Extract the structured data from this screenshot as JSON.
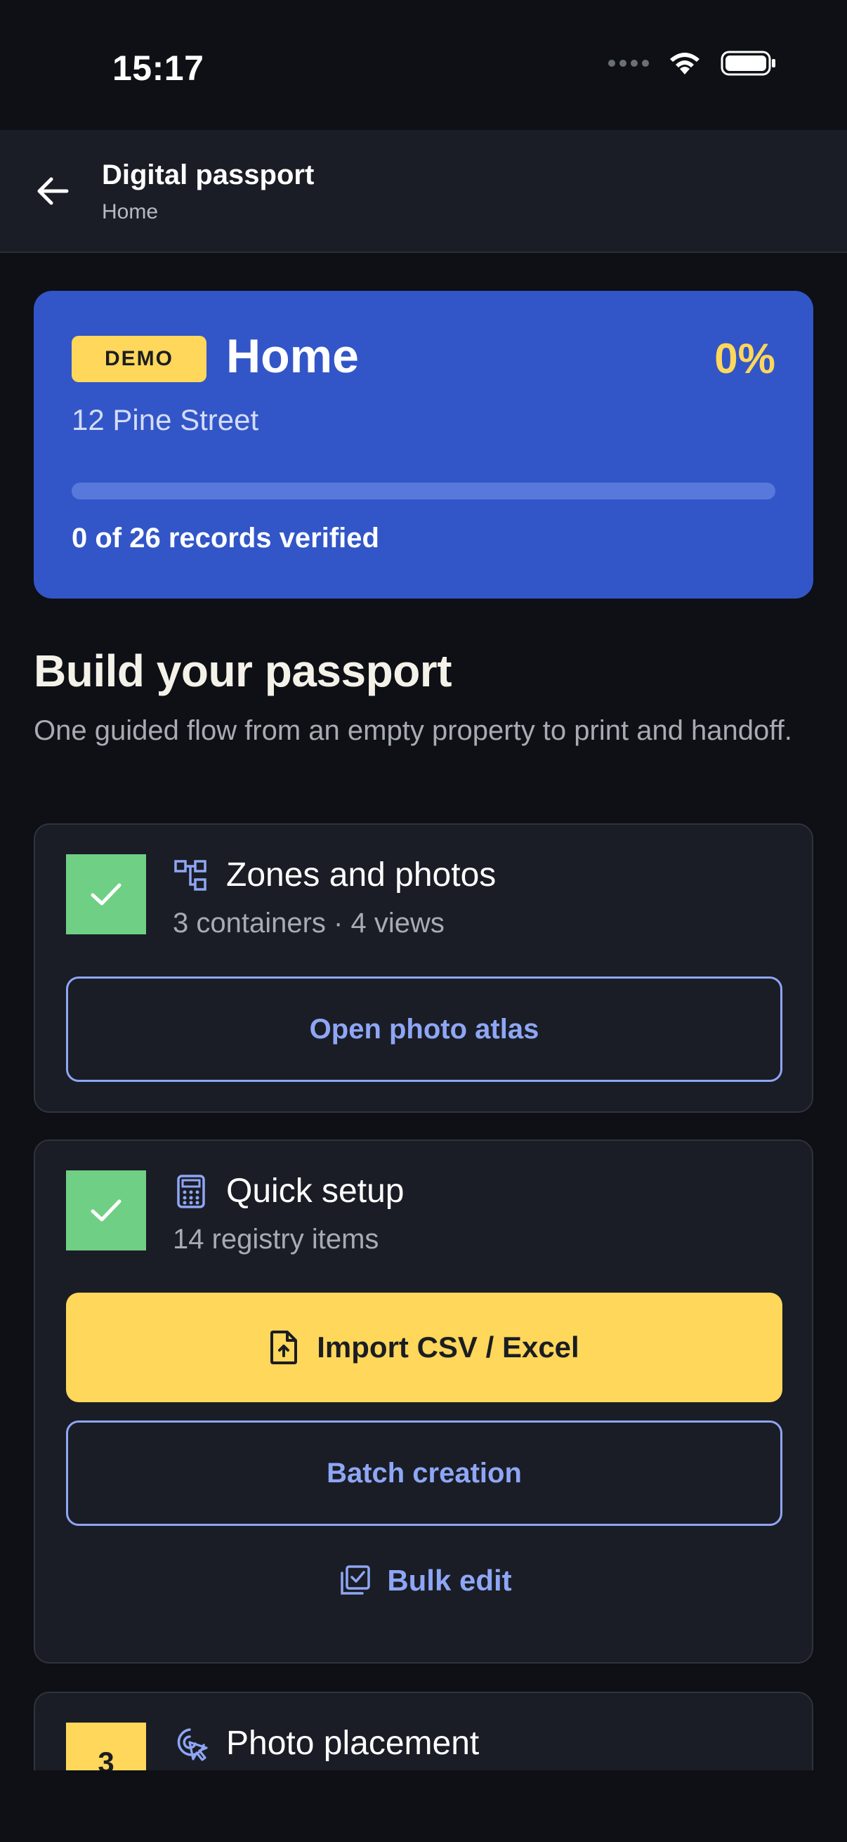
{
  "status_bar": {
    "time": "15:17"
  },
  "app_bar": {
    "title": "Digital passport",
    "subtitle": "Home"
  },
  "hero": {
    "badge": "DEMO",
    "title": "Home",
    "percent_label": "0%",
    "progress_fraction": 0,
    "address": "12 Pine Street",
    "records_text": "0 of 26 records verified"
  },
  "section": {
    "title": "Build your passport",
    "description": "One guided flow from an empty property to print and handoff."
  },
  "steps": [
    {
      "state": "done",
      "icon": "zones-icon",
      "title": "Zones and photos",
      "subtitle": "3 containers · 4 views",
      "buttons": {
        "outline": "Open photo atlas"
      }
    },
    {
      "state": "done",
      "icon": "calculator-icon",
      "title": "Quick setup",
      "subtitle": "14 registry items",
      "buttons": {
        "primary": "Import CSV / Excel",
        "outline": "Batch creation",
        "link": "Bulk edit"
      }
    },
    {
      "state": "pending",
      "number": "3",
      "icon": "cursor-click-icon",
      "title": "Photo placement"
    }
  ],
  "colors": {
    "background": "#0e1015",
    "card": "#1a1d25",
    "hero": "#3256c8",
    "accent_yellow": "#ffd75a",
    "accent_blue": "#8ea6f5",
    "done_green": "#6fcf84"
  }
}
